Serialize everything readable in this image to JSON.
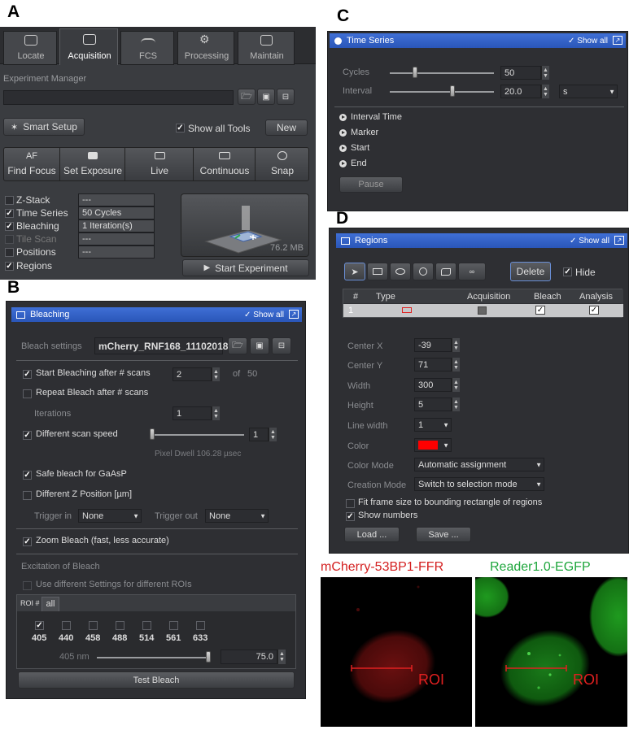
{
  "panel_labels": {
    "a": "A",
    "b": "B",
    "c": "C",
    "d": "D"
  },
  "panel_a": {
    "tabs": [
      {
        "label": "Locate",
        "icon": "locate-icon"
      },
      {
        "label": "Acquisition",
        "icon": "acquisition-icon"
      },
      {
        "label": "FCS",
        "icon": "fcs-icon"
      },
      {
        "label": "Processing",
        "icon": "processing-icon"
      },
      {
        "label": "Maintain",
        "icon": "maintain-icon"
      }
    ],
    "active_tab": "Acquisition",
    "experiment_manager_label": "Experiment Manager",
    "smart_setup_label": "Smart Setup",
    "show_all_tools_label": "Show all Tools",
    "new_label": "New",
    "actions": [
      {
        "top": "AF",
        "bottom": "Find Focus"
      },
      {
        "top": "camera-icon",
        "bottom": "Set Exposure"
      },
      {
        "top": "live-icon",
        "bottom": "Live"
      },
      {
        "top": "continuous-icon",
        "bottom": "Continuous"
      },
      {
        "top": "snap-icon",
        "bottom": "Snap"
      }
    ],
    "tools": [
      {
        "name": "Z-Stack",
        "checked": false,
        "value": "---"
      },
      {
        "name": "Time Series",
        "checked": true,
        "value": "50 Cycles"
      },
      {
        "name": "Bleaching",
        "checked": true,
        "value": "1 Iteration(s)"
      },
      {
        "name": "Tile Scan",
        "checked": false,
        "value": "---"
      },
      {
        "name": "Positions",
        "checked": false,
        "value": "---"
      },
      {
        "name": "Regions",
        "checked": true,
        "value": ""
      }
    ],
    "size_text": "76.2 MB",
    "start_experiment_label": "Start Experiment"
  },
  "panel_b": {
    "title": "Bleaching",
    "show_all": "Show all",
    "bleach_settings_label": "Bleach settings",
    "bleach_settings_value": "mCherry_RNF168_11102018",
    "start_bleaching_label": "Start Bleaching after # scans",
    "start_bleaching_value": "2",
    "of_label": "of",
    "of_value": "50",
    "repeat_label": "Repeat Bleach after # scans",
    "iterations_label": "Iterations",
    "iterations_value": "1",
    "diff_speed_label": "Different scan speed",
    "diff_speed_value": "1",
    "pixel_dwell": "Pixel Dwell   106.28 µsec",
    "safe_bleach_label": "Safe bleach for GaAsP",
    "diff_z_label": "Different Z Position [µm]",
    "trigger_in_label": "Trigger in",
    "trigger_in_value": "None",
    "trigger_out_label": "Trigger out",
    "trigger_out_value": "None",
    "zoom_bleach_label": "Zoom Bleach (fast, less accurate)",
    "excitation_label": "Excitation of Bleach",
    "use_diff_label": "Use different Settings for different ROIs",
    "roi_label": "ROI #",
    "roi_tab": "all",
    "wavelengths": [
      "405",
      "440",
      "458",
      "488",
      "514",
      "561",
      "633"
    ],
    "wavelength_checked": [
      true,
      false,
      false,
      false,
      false,
      false,
      false
    ],
    "laser_label": "405 nm",
    "laser_value": "75.0",
    "test_bleach_label": "Test Bleach"
  },
  "panel_c": {
    "title": "Time Series",
    "show_all": "Show all",
    "cycles_label": "Cycles",
    "cycles_value": "50",
    "interval_label": "Interval",
    "interval_value": "20.0",
    "interval_unit": "s",
    "items": [
      "Interval Time",
      "Marker",
      "Start",
      "End"
    ],
    "pause_label": "Pause"
  },
  "panel_d": {
    "title": "Regions",
    "show_all": "Show all",
    "delete_label": "Delete",
    "hide_label": "Hide",
    "table_headers": [
      "#",
      "Type",
      "Acquisition",
      "Bleach",
      "Analysis"
    ],
    "row_number": "1",
    "center_x_label": "Center X",
    "center_x_value": "-39",
    "center_y_label": "Center Y",
    "center_y_value": "71",
    "width_label": "Width",
    "width_value": "300",
    "height_label": "Height",
    "height_value": "5",
    "line_width_label": "Line width",
    "line_width_value": "1",
    "color_label": "Color",
    "color_value": "#ff0000",
    "color_mode_label": "Color Mode",
    "color_mode_value": "Automatic assignment",
    "creation_mode_label": "Creation Mode",
    "creation_mode_value": "Switch to selection mode",
    "fit_frame_label": "Fit frame size to bounding rectangle of regions",
    "show_numbers_label": "Show numbers",
    "load_label": "Load ...",
    "save_label": "Save ..."
  },
  "images": {
    "left_title": "mCherry-53BP1-FFR",
    "right_title": "Reader1.0-EGFP",
    "roi_label": "ROI",
    "left_title_color": "#d42020",
    "right_title_color": "#1ea63c"
  }
}
